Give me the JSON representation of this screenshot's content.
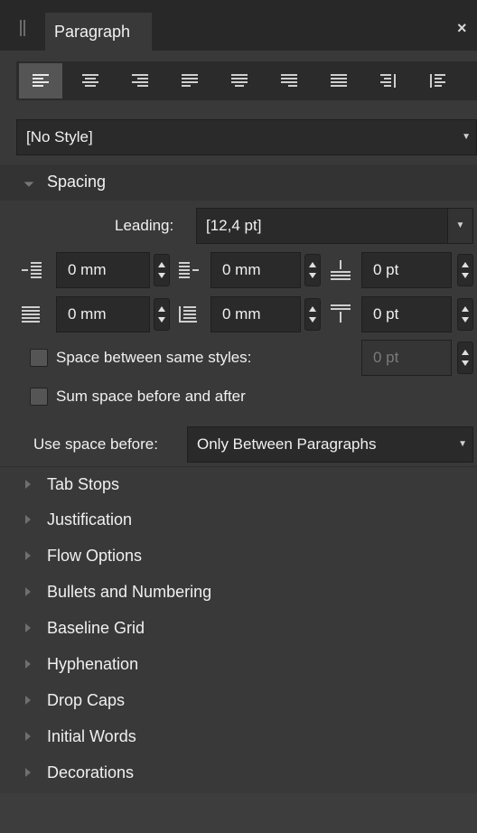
{
  "panel": {
    "tab_label": "Paragraph",
    "close_glyph": "×",
    "alignment_buttons": [
      {
        "name": "align-left",
        "active": true
      },
      {
        "name": "align-center",
        "active": false
      },
      {
        "name": "align-right",
        "active": false
      },
      {
        "name": "justify-left",
        "active": false
      },
      {
        "name": "justify-center",
        "active": false
      },
      {
        "name": "justify-right",
        "active": false
      },
      {
        "name": "justify-all",
        "active": false
      },
      {
        "name": "align-towards-spine",
        "active": false
      },
      {
        "name": "align-away-from-spine",
        "active": false
      }
    ],
    "style_select": "[No Style]"
  },
  "spacing": {
    "title": "Spacing",
    "leading_label": "Leading:",
    "leading_value": "[12,4 pt]",
    "left_indent": "0 mm",
    "right_indent": "0 mm",
    "space_before": "0 pt",
    "first_line_indent": "0 mm",
    "last_line_indent": "0 mm",
    "space_after": "0 pt",
    "same_styles_label": "Space between same styles:",
    "same_styles_value": "0 pt",
    "sum_label": "Sum space before and after",
    "use_space_label": "Use space before:",
    "use_space_value": "Only Between Paragraphs"
  },
  "sections": [
    "Tab Stops",
    "Justification",
    "Flow Options",
    "Bullets and Numbering",
    "Baseline Grid",
    "Hyphenation",
    "Drop Caps",
    "Initial Words",
    "Decorations"
  ],
  "colors": {
    "panel_bg": "#393939",
    "header_bg": "#282828",
    "field_bg": "#2a2a2a",
    "active_button": "#555555"
  }
}
